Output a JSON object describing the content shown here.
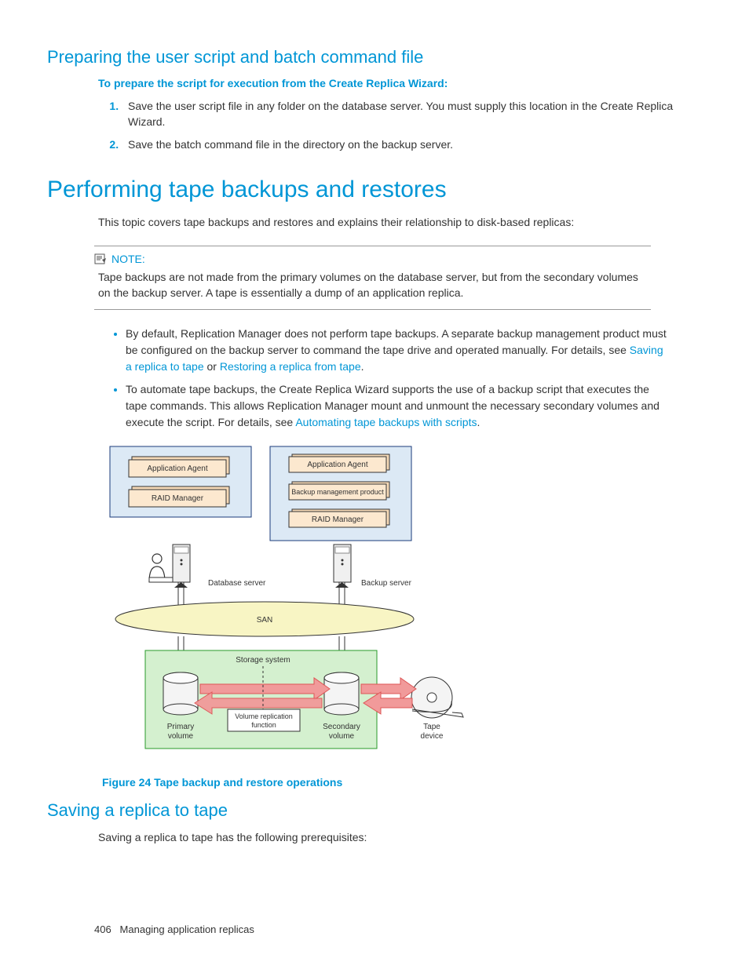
{
  "section1": {
    "heading": "Preparing the user script and batch command file",
    "subhead": "To prepare the script for execution from the Create Replica Wizard:",
    "steps": [
      "Save the user script file in any folder on the database server. You must supply this location in the Create Replica Wizard.",
      "Save the batch command file in the directory                 on the backup server."
    ]
  },
  "section2": {
    "heading": "Performing tape backups and restores",
    "intro": "This topic covers tape backups and restores and explains their relationship to disk-based replicas:",
    "note_label": "NOTE:",
    "note_text": "Tape backups are not made from the primary volumes on the database server, but from the secondary volumes on the backup server. A tape is essentially a dump of an application replica.",
    "bullets": [
      {
        "pre": "By default, Replication Manager does not perform tape backups. A separate backup management product must be configured on the backup server to command the tape drive and operated manually. For details, see ",
        "link1": "Saving a replica to tape",
        "mid": " or ",
        "link2": "Restoring a replica from tape",
        "post": "."
      },
      {
        "pre": "To automate tape backups, the Create Replica Wizard supports the use of a backup script that executes the tape commands. This allows Replication Manager mount and unmount the necessary secondary volumes and execute the script. For details, see ",
        "link1": "Automating tape backups with scripts",
        "post": "."
      }
    ]
  },
  "figure": {
    "caption": "Figure 24 Tape backup and restore operations",
    "labels": {
      "app_agent": "Application Agent",
      "raid_mgr": "RAID Manager",
      "backup_mgmt": "Backup management product",
      "db_server": "Database server",
      "backup_server": "Backup server",
      "san": "SAN",
      "storage": "Storage system",
      "primary": "Primary",
      "volume": "volume",
      "secondary": "Secondary",
      "vol_rep1": "Volume replication",
      "vol_rep2": "function",
      "tape": "Tape",
      "device": "device"
    }
  },
  "section3": {
    "heading": "Saving a replica to tape",
    "text": "Saving a replica to tape has the following prerequisites:"
  },
  "footer": {
    "page": "406",
    "title": "Managing application replicas"
  }
}
